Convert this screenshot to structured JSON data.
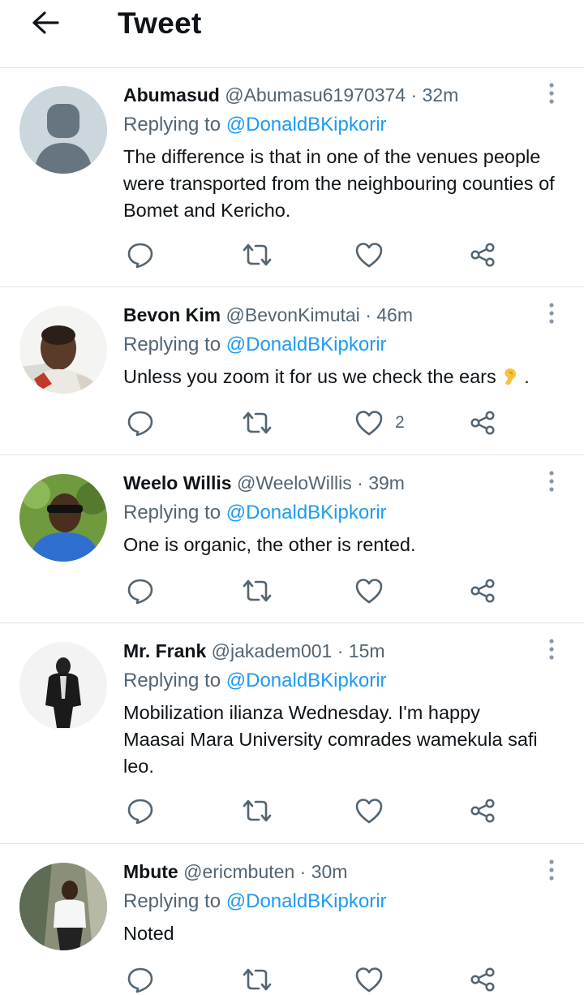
{
  "header": {
    "title": "Tweet",
    "back_icon": "arrow-left-icon"
  },
  "colors": {
    "link": "#1d9bf0",
    "muted": "#536471",
    "text": "#0f1419",
    "divider": "#e3e3e3"
  },
  "tweets": [
    {
      "name": "Abumasud",
      "handle": "@Abumasu61970374",
      "dot": "·",
      "time": "32m",
      "replying_prefix": "Replying to",
      "replying_to": "@DonaldBKipkorir",
      "text": "The difference is that in one of the venues people were transported from the neighbouring counties of Bomet and Kericho.",
      "likes": ""
    },
    {
      "name": "Bevon Kim",
      "handle": "@BevonKimutai",
      "dot": "·",
      "time": "46m",
      "replying_prefix": "Replying to",
      "replying_to": "@DonaldBKipkorir",
      "text": "Unless you zoom it for us we check the ears",
      "text_suffix": ".",
      "emoji": "ear-icon",
      "likes": "2"
    },
    {
      "name": "Weelo Willis",
      "handle": "@WeeloWillis",
      "dot": "·",
      "time": "39m",
      "replying_prefix": "Replying to",
      "replying_to": "@DonaldBKipkorir",
      "text": "One is organic, the other is rented.",
      "likes": ""
    },
    {
      "name": "Mr. Frank",
      "handle": "@jakadem001",
      "dot": "·",
      "time": "15m",
      "replying_prefix": "Replying to",
      "replying_to": "@DonaldBKipkorir",
      "text": "Mobilization ilianza Wednesday. I'm happy Maasai Mara University comrades wamekula safi leo.",
      "likes": ""
    },
    {
      "name": "Mbute",
      "handle": "@ericmbuten",
      "dot": "·",
      "time": "30m",
      "replying_prefix": "Replying to",
      "replying_to": "@DonaldBKipkorir",
      "text": "Noted",
      "likes": ""
    }
  ]
}
